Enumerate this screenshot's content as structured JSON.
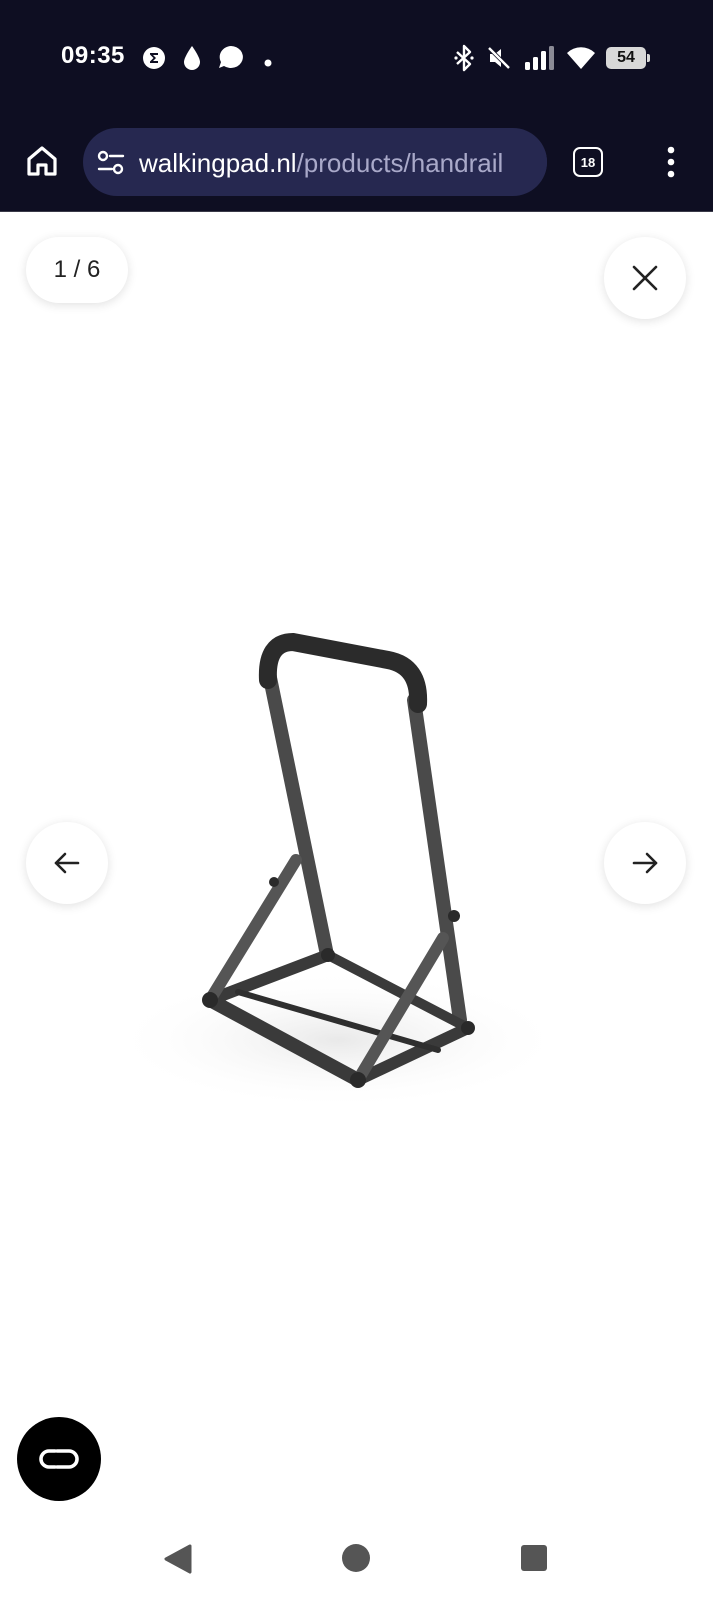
{
  "status_bar": {
    "time": "09:35",
    "notification_icons": [
      "sum-badge-icon",
      "water-drop-icon",
      "chat-bubble-icon",
      "dot-icon"
    ],
    "system_icons": [
      "bluetooth-icon",
      "mute-icon",
      "signal-icon",
      "wifi-icon"
    ],
    "battery": "54"
  },
  "browser": {
    "url_domain": "walkingpad.nl",
    "url_path": "/products/handrail",
    "tab_count": "18"
  },
  "gallery": {
    "counter": "1 / 6"
  },
  "colors": {
    "topbar_bg": "#0e0e22",
    "urlbar_bg": "#262850",
    "page_bg": "#ffffff",
    "chat_button_bg": "#000000"
  }
}
